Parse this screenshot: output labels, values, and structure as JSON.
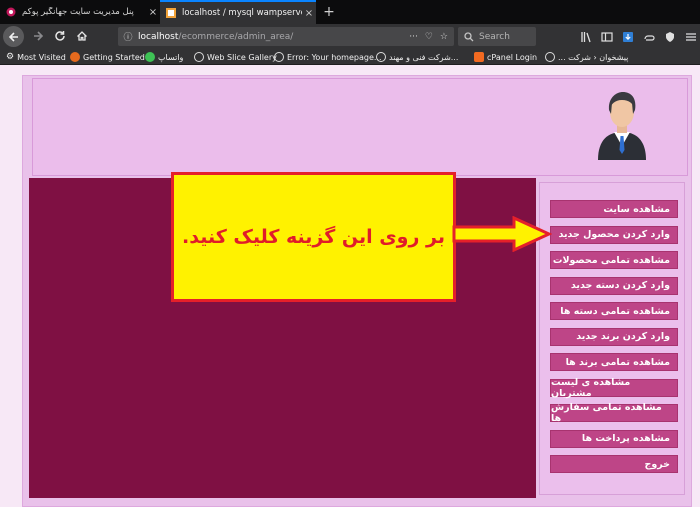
{
  "browser": {
    "tabs": [
      {
        "title": "پنل مدیریت سایت جهانگیر پوکم",
        "close": "×"
      },
      {
        "title": "localhost / mysql wampserver | php",
        "close": "×"
      }
    ],
    "new_tab": "+",
    "url": {
      "host": "localhost",
      "path": "/ecommerce/admin_area/"
    },
    "url_actions": [
      "···",
      "♡",
      "☆"
    ],
    "search_placeholder": "Search",
    "bookmarks": [
      {
        "label": "Most Visited",
        "icon": "gear-icon"
      },
      {
        "label": "Getting Started",
        "icon": "firefox-icon"
      },
      {
        "label": "واتساپ",
        "icon": "whatsapp-icon"
      },
      {
        "label": "Web Slice Gallery",
        "icon": "globe-icon"
      },
      {
        "label": "Error: Your homepage...",
        "icon": "globe-icon"
      },
      {
        "label": "شرکت فنی و مهند...",
        "icon": "globe-icon"
      },
      {
        "label": "cPanel Login",
        "icon": "cpanel-icon"
      },
      {
        "label": "پیشخوان ‹ شرکت ...",
        "icon": "globe-icon"
      }
    ]
  },
  "sidebar": {
    "items": [
      {
        "label": "مشاهده سایت"
      },
      {
        "label": "وارد کردن محصول جدید"
      },
      {
        "label": "مشاهده تمامی محصولات"
      },
      {
        "label": "وارد کردن دسته جدید"
      },
      {
        "label": "مشاهده تمامی دسته ها"
      },
      {
        "label": "وارد کردن برند جدید"
      },
      {
        "label": "مشاهده تمامی برند ها"
      },
      {
        "label": "مشاهده ی لیست مشتریان"
      },
      {
        "label": "مشاهده تمامی سفارش ها"
      },
      {
        "label": "مشاهده پرداخت ها"
      },
      {
        "label": "خروج"
      }
    ]
  },
  "callout": {
    "text": "بر روی این گزینه کلیک کنید."
  },
  "colors": {
    "main": "#7f1043",
    "menu_item": "#be4587",
    "callout_bg": "#fff200",
    "callout_border": "#e5202a"
  }
}
